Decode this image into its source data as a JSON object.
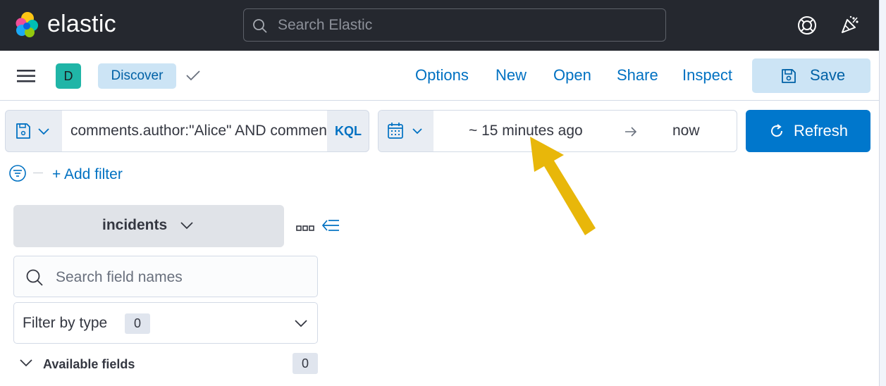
{
  "header": {
    "brand": "elastic",
    "search_placeholder": "Search Elastic",
    "icons": [
      "elastic-logo-icon",
      "search-icon",
      "help-icon",
      "news-feed-icon"
    ]
  },
  "appbar": {
    "avatar_letter": "D",
    "breadcrumb": "Discover",
    "links": {
      "options": "Options",
      "new": "New",
      "open": "Open",
      "share": "Share",
      "inspect": "Inspect"
    },
    "save_label": "Save"
  },
  "query": {
    "value": "comments.author:\"Alice\" AND comments.",
    "language": "KQL"
  },
  "time": {
    "start": "~ 15 minutes ago",
    "end": "now",
    "refresh_label": "Refresh"
  },
  "filters": {
    "add_label": "+ Add filter"
  },
  "sidebar": {
    "data_view": "incidents",
    "field_search_placeholder": "Search field names",
    "filter_by_type_label": "Filter by type",
    "filter_by_type_count": "0",
    "available_fields_label": "Available fields",
    "available_fields_count": "0"
  },
  "colors": {
    "header_bg": "#25282f",
    "link": "#0071c2",
    "primary": "#0077cc",
    "annotation_arrow": "#e8b70a"
  }
}
